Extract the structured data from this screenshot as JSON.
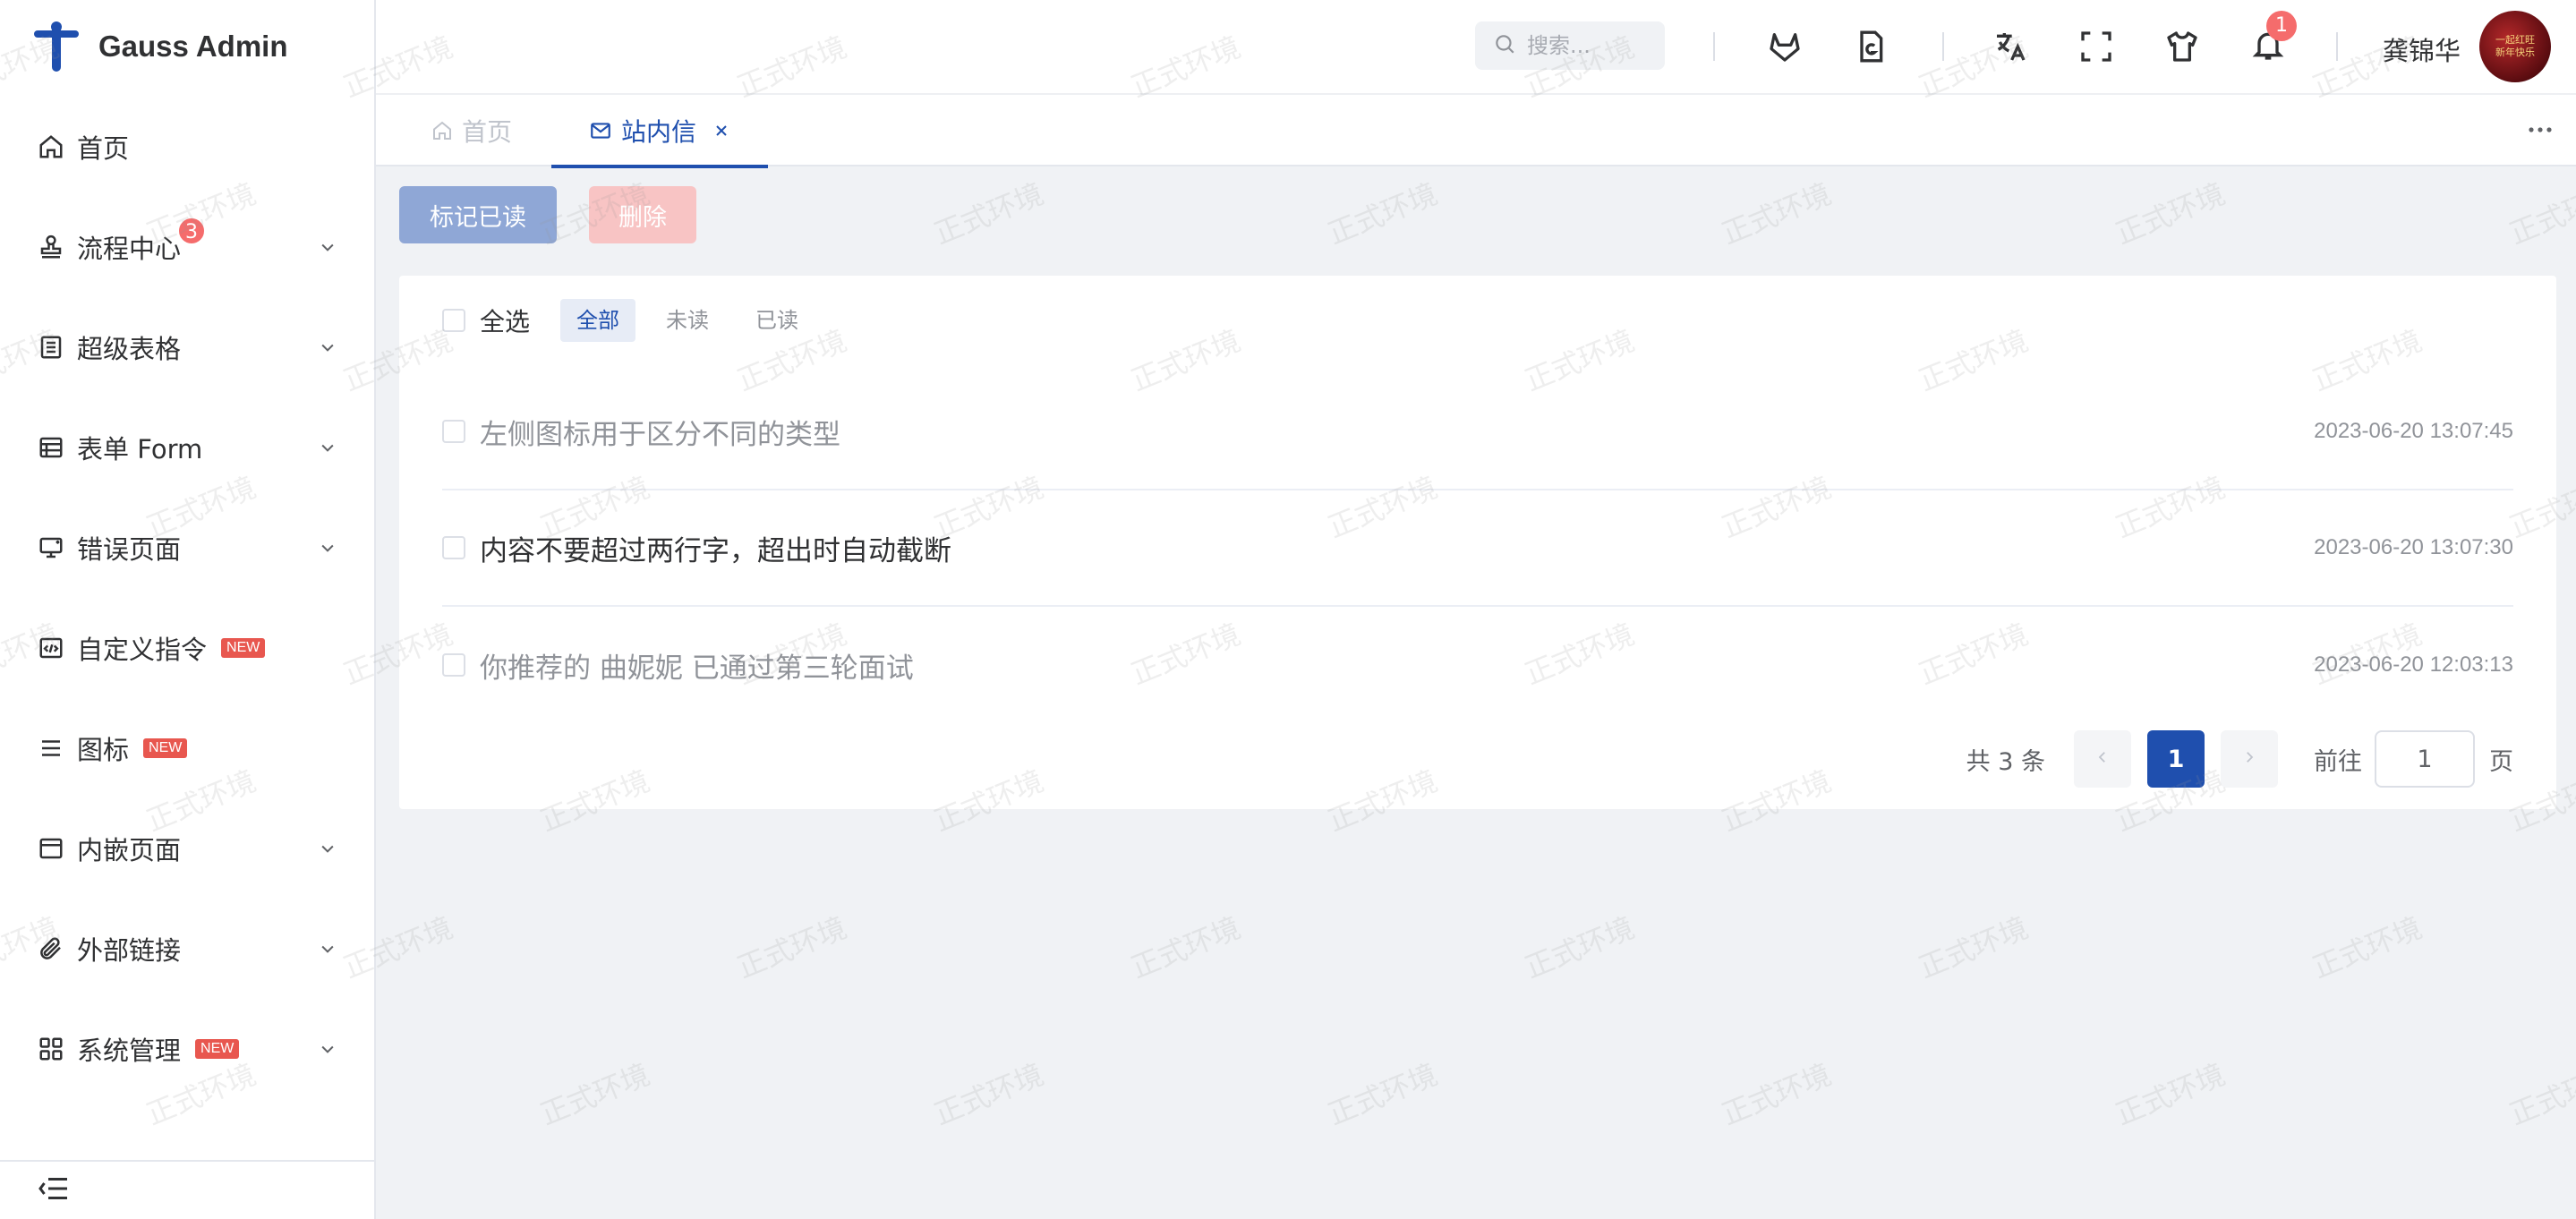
{
  "app": {
    "title": "Gauss Admin"
  },
  "sidebar": {
    "items": [
      {
        "label": "首页",
        "icon": "home-icon",
        "has_children": false
      },
      {
        "label": "流程中心",
        "icon": "stamp-icon",
        "has_children": true,
        "badge": "3"
      },
      {
        "label": "超级表格",
        "icon": "document-table-icon",
        "has_children": true
      },
      {
        "label": "表单 Form",
        "icon": "form-table-icon",
        "has_children": true
      },
      {
        "label": "错误页面",
        "icon": "monitor-error-icon",
        "has_children": true
      },
      {
        "label": "自定义指令",
        "icon": "code-icon",
        "has_children": false,
        "tag": "NEW"
      },
      {
        "label": "图标",
        "icon": "list-icon",
        "has_children": false,
        "tag": "NEW"
      },
      {
        "label": "内嵌页面",
        "icon": "window-icon",
        "has_children": true
      },
      {
        "label": "外部链接",
        "icon": "paperclip-icon",
        "has_children": true
      },
      {
        "label": "系统管理",
        "icon": "grid-icon",
        "has_children": true,
        "tag": "NEW"
      }
    ]
  },
  "header": {
    "search_placeholder": "搜索...",
    "notification_count": "1",
    "username": "龚锦华",
    "avatar_text_line1": "一起红旺",
    "avatar_text_line2": "新年快乐"
  },
  "tabs": [
    {
      "label": "首页",
      "icon": "home-icon",
      "active": false
    },
    {
      "label": "站内信",
      "icon": "mail-icon",
      "active": true,
      "closable": true
    }
  ],
  "toolbar": {
    "mark_read_label": "标记已读",
    "delete_label": "删除"
  },
  "filters": {
    "select_all_label": "全选",
    "options": [
      "全部",
      "未读",
      "已读"
    ],
    "active": "全部"
  },
  "messages": [
    {
      "title": "左侧图标用于区分不同的类型",
      "time": "2023-06-20 13:07:45",
      "read": true
    },
    {
      "title": "内容不要超过两行字，超出时自动截断",
      "time": "2023-06-20 13:07:30",
      "read": false
    },
    {
      "title": "你推荐的 曲妮妮 已通过第三轮面试",
      "time": "2023-06-20 12:03:13",
      "read": true
    }
  ],
  "pagination": {
    "total_text": "共 3 条",
    "current_page": "1",
    "goto_label": "前往",
    "goto_value": "1",
    "page_unit": "页"
  },
  "watermark": {
    "text": "正式环境"
  },
  "colors": {
    "primary": "#1f4fae",
    "danger_badge": "#f56c6c",
    "new_tag": "#e8574f"
  }
}
